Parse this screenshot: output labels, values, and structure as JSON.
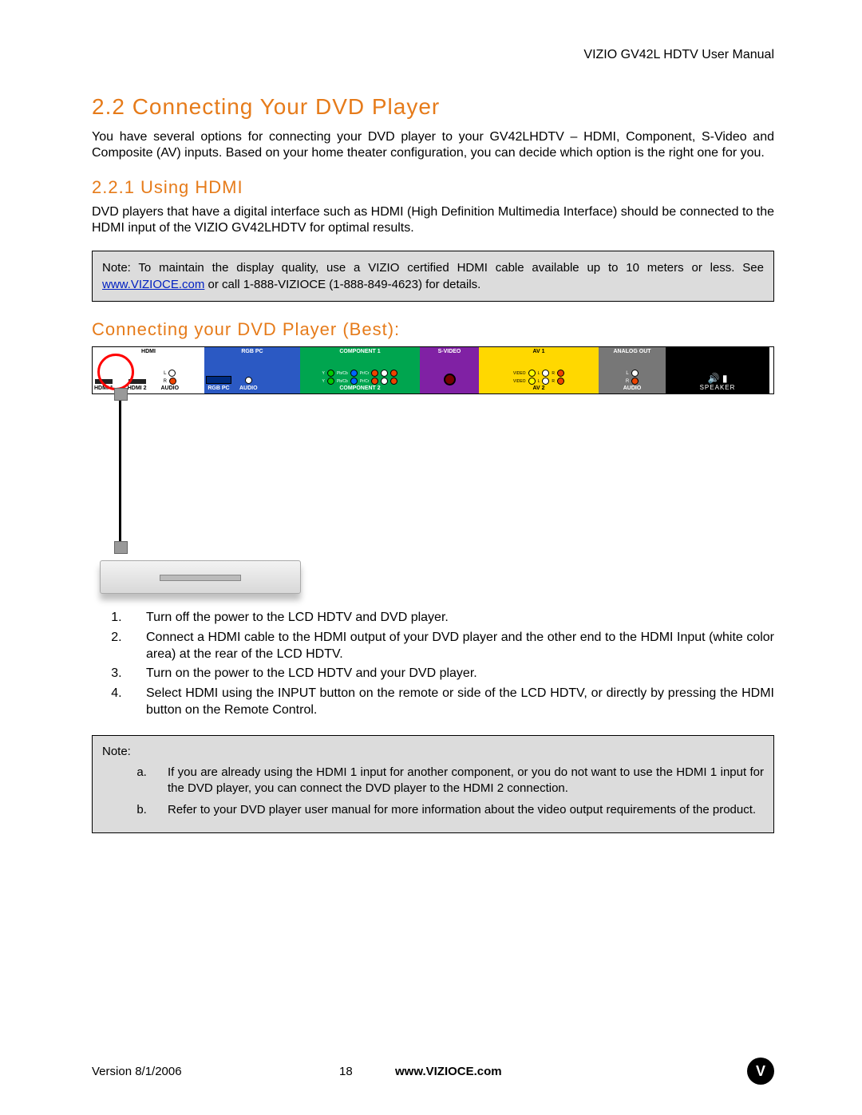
{
  "header": {
    "doc_header": "VIZIO GV42L HDTV User Manual"
  },
  "titles": {
    "h1": "2.2 Connecting Your DVD Player",
    "h2": "2.2.1 Using HDMI",
    "h3": "Connecting your DVD Player (Best):"
  },
  "intro": "You have several options for connecting your DVD player to your GV42LHDTV – HDMI, Component, S-Video and Composite (AV) inputs.  Based on your home theater configuration, you can decide which option is the right one for you.",
  "hdmi_para": "DVD players that have a digital interface such as HDMI (High Definition Multimedia Interface) should be connected to the HDMI input of the VIZIO GV42LHDTV for optimal results.",
  "note1": {
    "pre": "Note: To maintain the display quality, use a VIZIO certified HDMI cable available up to 10 meters or less.  See ",
    "link": "www.VIZIOCE.com",
    "post": " or call 1-888-VIZIOCE (1-888-849-4623) for details."
  },
  "panel": {
    "hdmi_top": "HDMI",
    "hdmi1": "HDMI 1",
    "hdmi2": "HDMI 2",
    "lr_l": "L",
    "lr_r": "R",
    "audio": "AUDIO",
    "rgb_top": "RGB PC",
    "rgb_bot": "RGB PC",
    "comp_top": "COMPONENT 1",
    "comp_bot": "COMPONENT 2",
    "comp_y": "Y",
    "comp_pb": "Pb/Cb",
    "comp_pr": "Pr/Cr",
    "sv_top": "S-VIDEO",
    "av_top": "AV 1",
    "av_bot": "AV 2",
    "av_video": "VIDEO",
    "analog_top": "ANALOG OUT",
    "speaker": "SPEAKER"
  },
  "steps": [
    "Turn off the power to the LCD HDTV and DVD player.",
    "Connect a HDMI cable to the HDMI output of your DVD player and the other end to the HDMI Input (white color area) at the rear of the LCD HDTV.",
    "Turn on the power to the LCD HDTV and your DVD player.",
    "Select HDMI using the INPUT button on the remote or side of the LCD HDTV, or directly by pressing the HDMI button on the Remote Control."
  ],
  "note2": {
    "title": "Note:",
    "items": [
      "If you are already using the HDMI 1 input for another component, or you do not want to use the HDMI 1 input for the DVD player, you can connect the DVD player to the HDMI 2 connection.",
      "Refer to your DVD player user manual for more information about the video output requirements of the product."
    ]
  },
  "footer": {
    "version": "Version 8/1/2006",
    "page": "18",
    "site": "www.VIZIOCE.com",
    "logo": "V"
  }
}
